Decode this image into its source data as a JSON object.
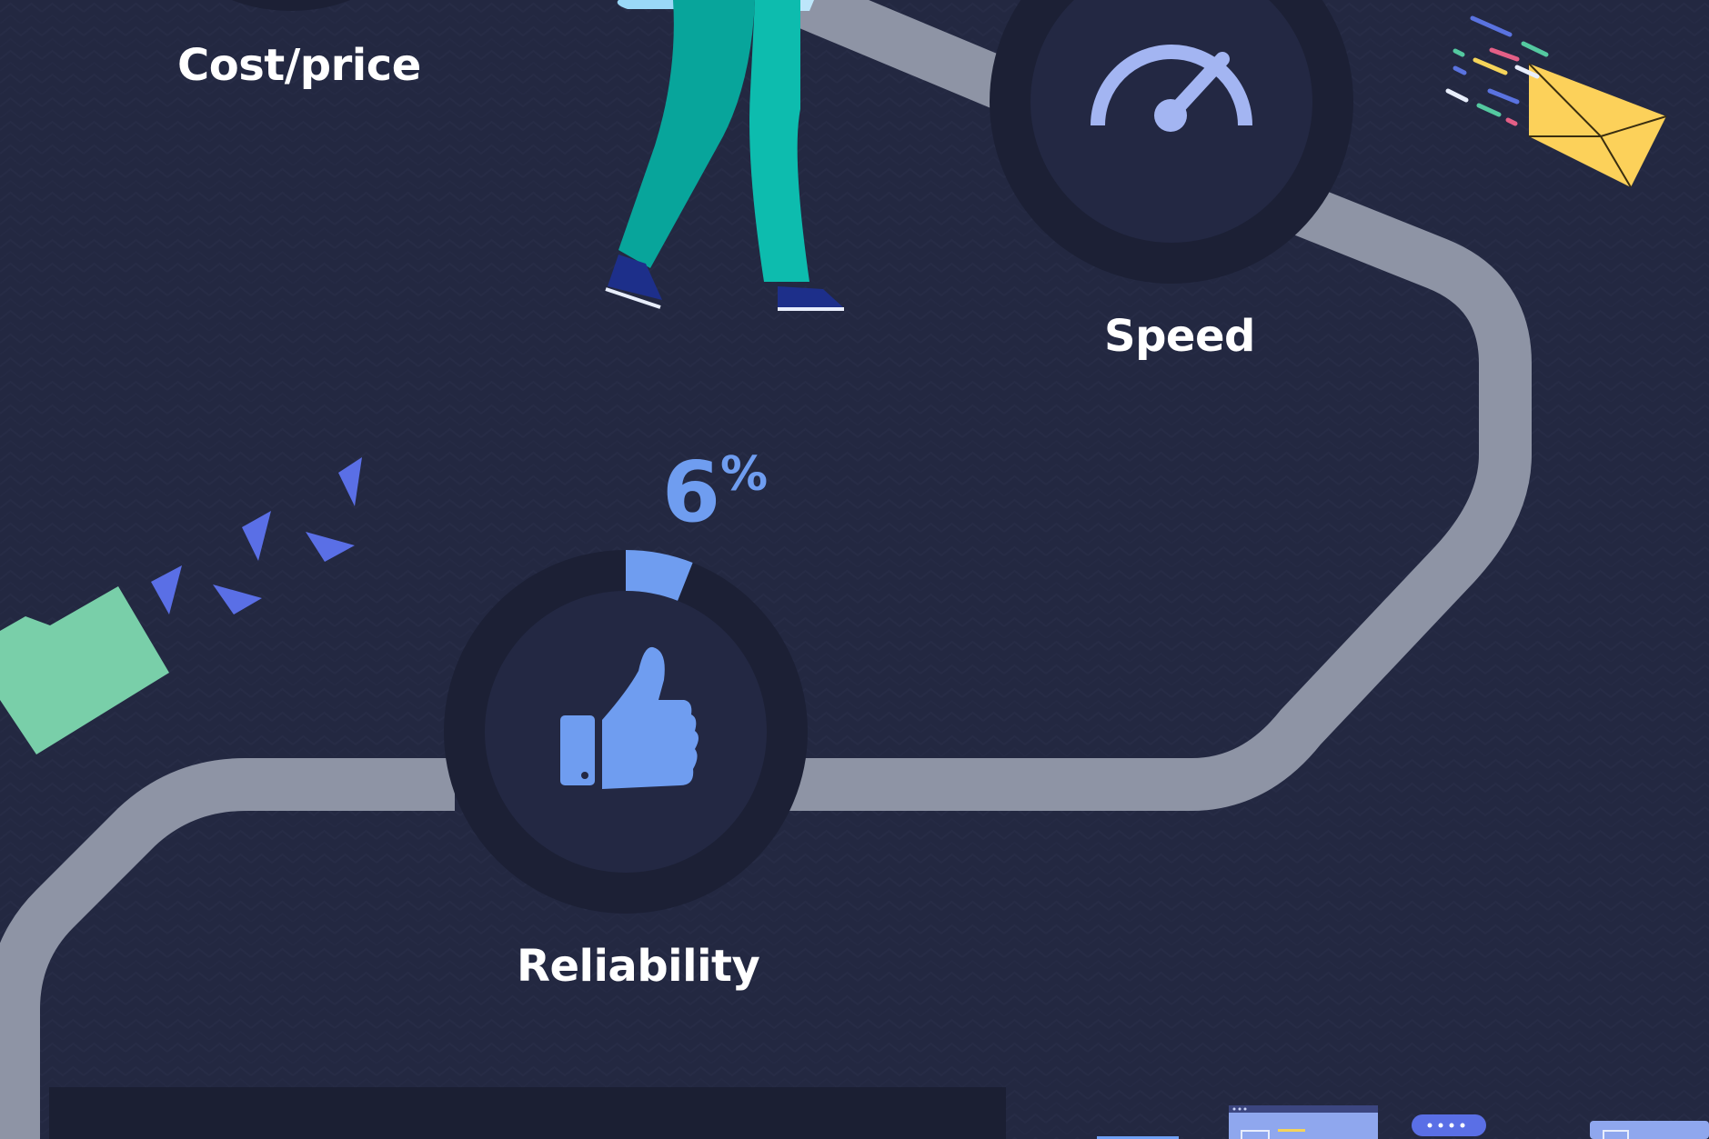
{
  "metrics": [
    {
      "label": "Cost/price",
      "icon": "partial-circle-icon"
    },
    {
      "label": "Speed",
      "icon": "speedometer-icon"
    },
    {
      "label": "Reliability",
      "icon": "thumbs-up-icon",
      "percent_value": "6",
      "percent_symbol": "%",
      "ring_fill_percent": 6
    }
  ],
  "decorations": {
    "envelope": "envelope-icon",
    "folder": "folder-icon",
    "person": "walking-person-illustration"
  },
  "colors": {
    "background": "#232841",
    "path": "#8e94a5",
    "ring": "#1c2035",
    "ring_inner": "#232843",
    "accent_blue": "#6f9df0",
    "envelope_yellow": "#fcd15a",
    "folder_green": "#79cfa9",
    "label_white": "#ffffff"
  }
}
